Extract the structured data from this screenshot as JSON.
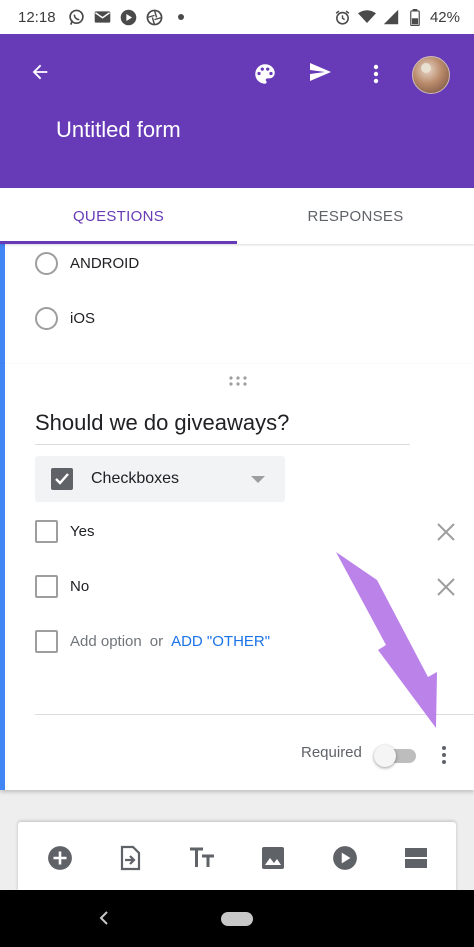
{
  "status_bar": {
    "time": "12:18",
    "battery_percent": "42%",
    "left_icons": [
      "whatsapp-icon",
      "gmail-icon",
      "media-icon",
      "aperture-icon",
      "dot-icon"
    ],
    "right_icons": [
      "alarm-icon",
      "wifi-icon",
      "signal-icon",
      "battery-icon"
    ]
  },
  "app_bar": {
    "title": "Untitled form",
    "color": "#673ab7",
    "actions": [
      "back-arrow-icon",
      "palette-icon",
      "send-icon",
      "more-vert-icon",
      "avatar"
    ]
  },
  "tabs": [
    {
      "label": "QUESTIONS",
      "active": true
    },
    {
      "label": "RESPONSES",
      "active": false
    }
  ],
  "previous_question": {
    "options": [
      "ANDROID",
      "iOS"
    ]
  },
  "active_question": {
    "title": "Should we do giveaways?",
    "type_label": "Checkboxes",
    "options": [
      "Yes",
      "No"
    ],
    "add_option_label": "Add option",
    "or_label": "or",
    "add_other_label": "ADD \"OTHER\"",
    "required_label": "Required",
    "required": false,
    "accent_color": "#4285f4"
  },
  "bottom_toolbar": {
    "tools": [
      "add-question-icon",
      "import-questions-icon",
      "add-title-icon",
      "add-image-icon",
      "add-video-icon",
      "add-section-icon"
    ]
  },
  "annotation": {
    "arrow_color": "#b77be8"
  }
}
